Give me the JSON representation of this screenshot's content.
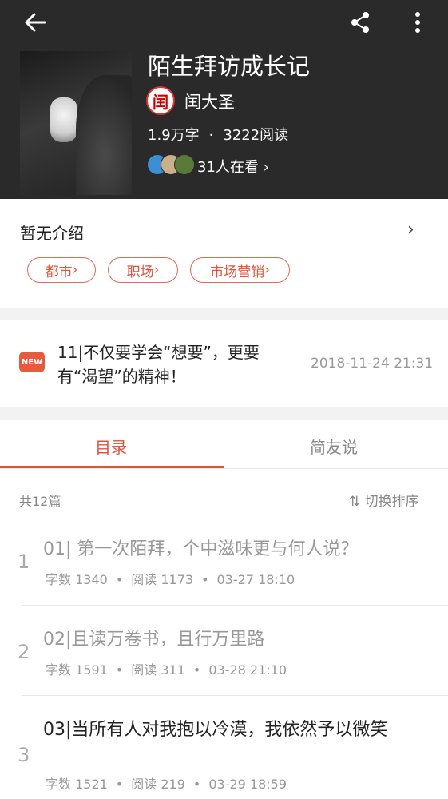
{
  "header": {
    "book_title": "陌生拜访成长记",
    "author_name": "闰大圣",
    "author_avatar_text": "闰",
    "word_count": "1.9万字",
    "read_count": "3222阅读",
    "readers_text": "31人在看",
    "stats_separator": "·",
    "chevron": "›",
    "icons": [
      "back-arrow-icon",
      "share-icon",
      "more-vertical-icon"
    ]
  },
  "intro": {
    "text": "暂无介绍",
    "chevron": "›",
    "tags": [
      "都市",
      "职场",
      "市场营销"
    ],
    "tag_chevron": "›"
  },
  "latest_update": {
    "badge": "NEW",
    "title": "11|不仅要学会“想要”，更要有“渴望”的精神！",
    "time": "2018-11-24 21:31"
  },
  "tabs": {
    "toc": "目录",
    "friends": "简友说",
    "active": "目录"
  },
  "toc": {
    "total": "共12篇",
    "sort_label": "切换排序",
    "sort_icon": "⇅",
    "chapters": [
      {
        "num": "1",
        "title": "01| 第一次陌拜，个中滋味更与何人说？",
        "words": "字数 1340",
        "reads": "阅读 1173",
        "date": "03-27 18:10",
        "read": true
      },
      {
        "num": "2",
        "title": "02|且读万卷书，且行万里路",
        "words": "字数 1591",
        "reads": "阅读 311",
        "date": "03-28 21:10",
        "read": true
      },
      {
        "num": "3",
        "title": "03|当所有人对我抱以冷漠，我依然予以微笑",
        "words": "字数 1521",
        "reads": "阅读 219",
        "date": "03-29 18:59",
        "read": false
      }
    ]
  },
  "colors": {
    "accent": "#e0533c",
    "header_bg": "#2a2a2a",
    "read_title": "#999999",
    "unread_title": "#222222"
  }
}
